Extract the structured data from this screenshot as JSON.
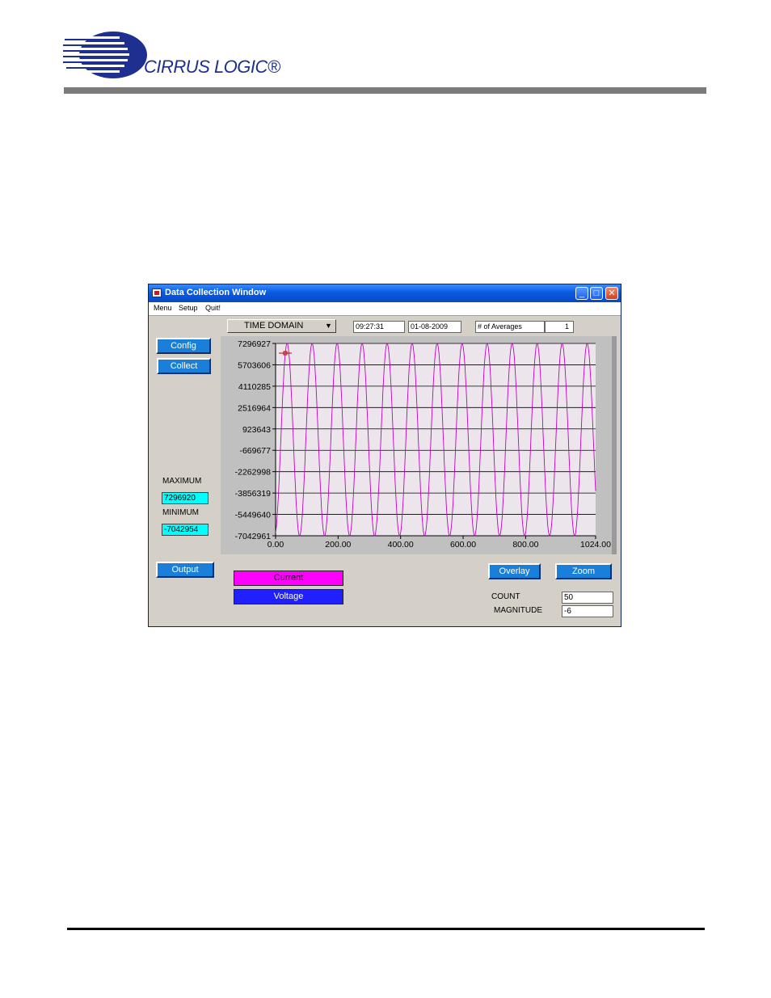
{
  "header": {
    "brand": "CIRRUS LOGIC®"
  },
  "window": {
    "title": "Data Collection Window",
    "menu": [
      "Menu",
      "Setup",
      "Quit!"
    ],
    "buttons": {
      "minimize": "_",
      "maximize": "□",
      "close": "✕"
    },
    "controls": {
      "config": "Config",
      "collect": "Collect",
      "output": "Output",
      "overlay": "Overlay",
      "zoom": "Zoom"
    },
    "view_select": "TIME DOMAIN",
    "time": "09:27:31",
    "date": "01-08-2009",
    "averages_label": "# of Averages",
    "averages_value": "1",
    "maximum_label": "MAXIMUM",
    "maximum_value": "7296920",
    "minimum_label": "MINIMUM",
    "minimum_value": "-7042954",
    "legend": {
      "current": "Current",
      "voltage": "Voltage",
      "current_color": "#ff00ff",
      "voltage_color": "#2020ff"
    },
    "count_label": "COUNT",
    "count_value": "50",
    "magnitude_label": "MAGNITUDE",
    "magnitude_value": "-6"
  },
  "chart_data": {
    "type": "line",
    "title": "",
    "xlabel": "",
    "ylabel": "",
    "xlim": [
      0,
      1024
    ],
    "ylim": [
      -7042961,
      7296927
    ],
    "x_ticks": [
      "0.00",
      "200.00",
      "400.00",
      "600.00",
      "800.00",
      "1024.00"
    ],
    "y_ticks": [
      "7296927",
      "5703606",
      "4110285",
      "2516964",
      "923643",
      "-669677",
      "-2262998",
      "-3856319",
      "-5449640",
      "-7042961"
    ],
    "grid": true,
    "series": [
      {
        "color": "#c000c0",
        "waveform": "sine",
        "cycles": 12.8,
        "amplitude_max": 7296920,
        "amplitude_min": -7042954,
        "samples": 1024
      }
    ]
  }
}
